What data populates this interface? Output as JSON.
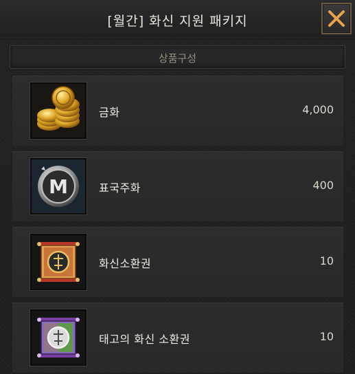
{
  "window": {
    "title": "[월간] 화신 지원 패키지"
  },
  "close_button": {
    "icon": "close-icon"
  },
  "section": {
    "label": "상품구성"
  },
  "items": [
    {
      "name": "금화",
      "quantity": "4,000",
      "icon": "gold-coins-icon"
    },
    {
      "name": "표국주화",
      "quantity": "400",
      "icon": "m-coin-icon"
    },
    {
      "name": "화신소환권",
      "quantity": "10",
      "icon": "summon-scroll-icon"
    },
    {
      "name": "태고의 화신 소환권",
      "quantity": "10",
      "icon": "ancient-summon-scroll-icon"
    }
  ]
}
